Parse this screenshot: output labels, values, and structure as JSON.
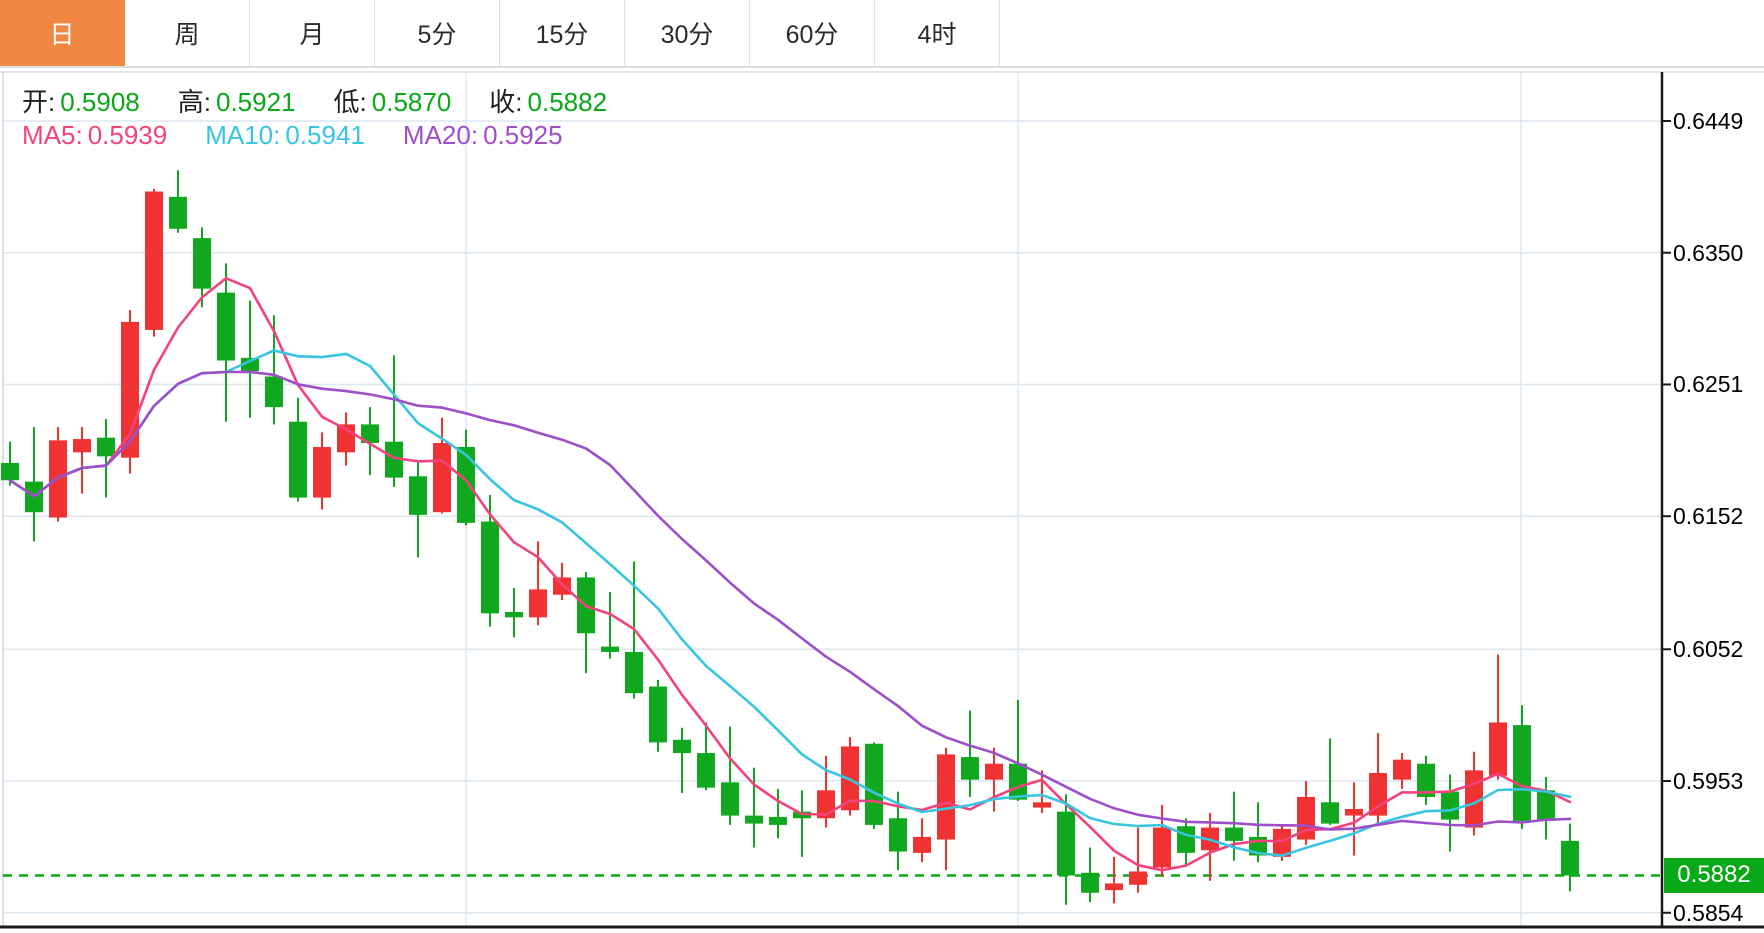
{
  "tabs": {
    "items": [
      {
        "label": "日",
        "active": true
      },
      {
        "label": "周",
        "active": false
      },
      {
        "label": "月",
        "active": false
      },
      {
        "label": "5分",
        "active": false
      },
      {
        "label": "15分",
        "active": false
      },
      {
        "label": "30分",
        "active": false
      },
      {
        "label": "60分",
        "active": false
      },
      {
        "label": "4时",
        "active": false
      }
    ]
  },
  "legend": {
    "ohlc": [
      {
        "key": "open",
        "label": "开:",
        "value": "0.5908"
      },
      {
        "key": "high",
        "label": "高:",
        "value": "0.5921"
      },
      {
        "key": "low",
        "label": "低:",
        "value": "0.5870"
      },
      {
        "key": "close",
        "label": "收:",
        "value": "0.5882"
      }
    ],
    "ma": [
      {
        "name": "MA5",
        "label": "MA5:",
        "value": "0.5939",
        "color": "#f2437e"
      },
      {
        "name": "MA10",
        "label": "MA10:",
        "value": "0.5941",
        "color": "#38c5e0"
      },
      {
        "name": "MA20",
        "label": "MA20:",
        "value": "0.5925",
        "color": "#9e4fc8"
      }
    ]
  },
  "y_axis": {
    "tick_labels": [
      "0.6449",
      "0.6350",
      "0.6251",
      "0.6152",
      "0.6052",
      "0.5953",
      "0.5854"
    ],
    "current_price_label": "0.5882"
  },
  "colors": {
    "up_candle": "#ef3333",
    "down_candle": "#10a81e",
    "ma5": "#f2437e",
    "ma10": "#38c5e0",
    "ma20": "#9e4fc8",
    "grid": "#dde7f0",
    "axis": "#1a1a1a",
    "current_price": "#09a818",
    "tab_active_bg": "#f08843",
    "legend_value_green": "#09a818"
  },
  "chart_data": {
    "type": "candlestick",
    "title": "",
    "xlabel": "",
    "ylabel": "",
    "grid": true,
    "y_ticks": [
      0.6449,
      0.635,
      0.6251,
      0.6152,
      0.6052,
      0.5953,
      0.5854
    ],
    "ylim": [
      0.5824,
      0.6487
    ],
    "current_price": 0.5882,
    "last_ohlc": {
      "open": 0.5908,
      "high": 0.5921,
      "low": 0.587,
      "close": 0.5882
    },
    "ma_periods": [
      5,
      10,
      20
    ],
    "ma_last_values": {
      "MA5": 0.5939,
      "MA10": 0.5941,
      "MA20": 0.5925
    },
    "candles_format": [
      "open",
      "high",
      "low",
      "close"
    ],
    "candles": [
      [
        0.6192,
        0.6208,
        0.6175,
        0.6179
      ],
      [
        0.6178,
        0.6219,
        0.6133,
        0.6155
      ],
      [
        0.6151,
        0.6219,
        0.6148,
        0.6209
      ],
      [
        0.62,
        0.6219,
        0.6169,
        0.621
      ],
      [
        0.6211,
        0.6225,
        0.6166,
        0.6197
      ],
      [
        0.6196,
        0.6307,
        0.6184,
        0.6298
      ],
      [
        0.6292,
        0.6398,
        0.6287,
        0.6396
      ],
      [
        0.6392,
        0.6412,
        0.6365,
        0.6368
      ],
      [
        0.6361,
        0.6369,
        0.6309,
        0.6323
      ],
      [
        0.632,
        0.6342,
        0.6223,
        0.6269
      ],
      [
        0.6271,
        0.6314,
        0.6226,
        0.6261
      ],
      [
        0.6257,
        0.6303,
        0.6221,
        0.6234
      ],
      [
        0.6223,
        0.6241,
        0.6163,
        0.6166
      ],
      [
        0.6166,
        0.6215,
        0.6157,
        0.6204
      ],
      [
        0.62,
        0.623,
        0.619,
        0.6221
      ],
      [
        0.6221,
        0.6234,
        0.6183,
        0.6207
      ],
      [
        0.6208,
        0.6273,
        0.6174,
        0.6181
      ],
      [
        0.6182,
        0.6193,
        0.6121,
        0.6153
      ],
      [
        0.6155,
        0.6226,
        0.6154,
        0.6207
      ],
      [
        0.6204,
        0.6217,
        0.6145,
        0.6147
      ],
      [
        0.6148,
        0.6168,
        0.6069,
        0.6079
      ],
      [
        0.608,
        0.6098,
        0.6061,
        0.6076
      ],
      [
        0.6076,
        0.6133,
        0.607,
        0.6097
      ],
      [
        0.6093,
        0.6117,
        0.6089,
        0.6106
      ],
      [
        0.6106,
        0.611,
        0.6034,
        0.6064
      ],
      [
        0.6054,
        0.6095,
        0.6045,
        0.605
      ],
      [
        0.605,
        0.6118,
        0.6015,
        0.6019
      ],
      [
        0.6024,
        0.6029,
        0.5975,
        0.5982
      ],
      [
        0.5984,
        0.5993,
        0.5944,
        0.5974
      ],
      [
        0.5974,
        0.5997,
        0.5946,
        0.5948
      ],
      [
        0.5952,
        0.5994,
        0.592,
        0.5927
      ],
      [
        0.5927,
        0.5963,
        0.5903,
        0.5921
      ],
      [
        0.5926,
        0.5947,
        0.591,
        0.592
      ],
      [
        0.593,
        0.5946,
        0.5896,
        0.5925
      ],
      [
        0.5925,
        0.5972,
        0.5918,
        0.5946
      ],
      [
        0.5931,
        0.5986,
        0.5927,
        0.5979
      ],
      [
        0.5981,
        0.5982,
        0.5917,
        0.592
      ],
      [
        0.5925,
        0.5945,
        0.5886,
        0.59
      ],
      [
        0.5899,
        0.5925,
        0.5892,
        0.5911
      ],
      [
        0.5909,
        0.5978,
        0.5886,
        0.5973
      ],
      [
        0.5971,
        0.6006,
        0.5941,
        0.5954
      ],
      [
        0.5954,
        0.5978,
        0.593,
        0.5966
      ],
      [
        0.5966,
        0.6014,
        0.5938,
        0.5939
      ],
      [
        0.5933,
        0.5961,
        0.5929,
        0.5937
      ],
      [
        0.593,
        0.5943,
        0.586,
        0.5882
      ],
      [
        0.5884,
        0.5903,
        0.5862,
        0.5869
      ],
      [
        0.5871,
        0.5896,
        0.5861,
        0.5876
      ],
      [
        0.5875,
        0.5918,
        0.5869,
        0.5885
      ],
      [
        0.5888,
        0.5935,
        0.5881,
        0.5918
      ],
      [
        0.5919,
        0.5925,
        0.589,
        0.5899
      ],
      [
        0.5901,
        0.5929,
        0.5878,
        0.5918
      ],
      [
        0.5918,
        0.5945,
        0.5893,
        0.5908
      ],
      [
        0.5911,
        0.5937,
        0.5892,
        0.5897
      ],
      [
        0.5896,
        0.5919,
        0.5893,
        0.5917
      ],
      [
        0.5909,
        0.5953,
        0.5905,
        0.5941
      ],
      [
        0.5937,
        0.5985,
        0.592,
        0.5921
      ],
      [
        0.5927,
        0.5952,
        0.5897,
        0.5932
      ],
      [
        0.5927,
        0.5989,
        0.5921,
        0.5959
      ],
      [
        0.5954,
        0.5974,
        0.5947,
        0.5969
      ],
      [
        0.5966,
        0.5972,
        0.5935,
        0.5941
      ],
      [
        0.5945,
        0.5958,
        0.59,
        0.5924
      ],
      [
        0.5918,
        0.5975,
        0.5912,
        0.5961
      ],
      [
        0.5957,
        0.6048,
        0.5954,
        0.5997
      ],
      [
        0.5995,
        0.601,
        0.5917,
        0.5923
      ],
      [
        0.5946,
        0.5956,
        0.5909,
        0.5923
      ],
      [
        0.5908,
        0.5921,
        0.587,
        0.5882
      ]
    ]
  }
}
